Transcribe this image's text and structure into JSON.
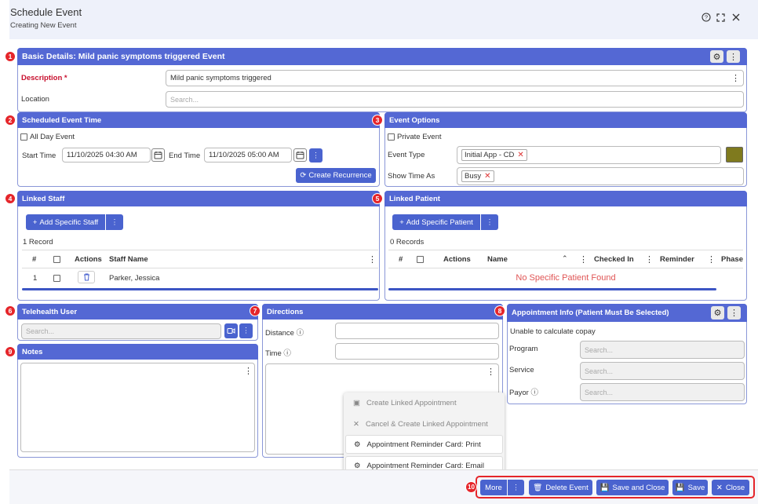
{
  "header": {
    "title": "Schedule Event",
    "subtitle": "Creating New Event",
    "help_icon": "?",
    "expand_icon": "⛶",
    "close_icon": "✕"
  },
  "badges": [
    "1",
    "2",
    "3",
    "4",
    "5",
    "6",
    "7",
    "8",
    "9",
    "10"
  ],
  "basic": {
    "title": "Basic Details: Mild panic symptoms triggered Event",
    "description_label": "Description *",
    "description_value": "Mild panic symptoms triggered",
    "location_label": "Location",
    "location_placeholder": "Search..."
  },
  "scheduled": {
    "title": "Scheduled Event Time",
    "all_day": "All Day Event",
    "start_label": "Start Time",
    "start_value": "11/10/2025 04:30 AM",
    "end_label": "End Time",
    "end_value": "11/10/2025 05:00 AM",
    "recurrence_button": "Create Recurrence"
  },
  "options": {
    "title": "Event Options",
    "private": "Private Event",
    "type_label": "Event Type",
    "type_value": "Initial App - CD",
    "show_label": "Show Time As",
    "show_value": "Busy",
    "color": "#7f7a1e"
  },
  "staff": {
    "title": "Linked Staff",
    "add_button": "Add Specific Staff",
    "records": "1 Record",
    "columns": [
      "#",
      "Actions",
      "Staff Name"
    ],
    "rows": [
      {
        "num": "1",
        "name": "Parker, Jessica"
      }
    ]
  },
  "patient": {
    "title": "Linked Patient",
    "add_button": "Add Specific Patient",
    "records": "0 Records",
    "columns": [
      "#",
      "Actions",
      "Name",
      "Checked In",
      "Reminder",
      "Phase"
    ],
    "empty": "No Specific Patient Found"
  },
  "telehealth": {
    "title": "Telehealth User",
    "placeholder": "Search..."
  },
  "notes": {
    "title": "Notes"
  },
  "directions": {
    "title": "Directions",
    "distance_label": "Distance",
    "time_label": "Time"
  },
  "appointment": {
    "title": "Appointment Info (Patient Must Be Selected)",
    "copay": "Unable to calculate copay",
    "program_label": "Program",
    "service_label": "Service",
    "payor_label": "Payor",
    "placeholder": "Search..."
  },
  "menu": {
    "items": [
      "Create Linked Appointment",
      "Cancel & Create Linked Appointment",
      "Appointment Reminder Card: Print",
      "Appointment Reminder Card: Email"
    ]
  },
  "footer": {
    "more": "More",
    "delete": "Delete Event",
    "save_close": "Save and Close",
    "save": "Save",
    "close": "Close"
  },
  "colors": {
    "accent": "#5468d4",
    "button": "#4a63cf",
    "badge": "#e5252a",
    "empty_text": "#e05555"
  }
}
